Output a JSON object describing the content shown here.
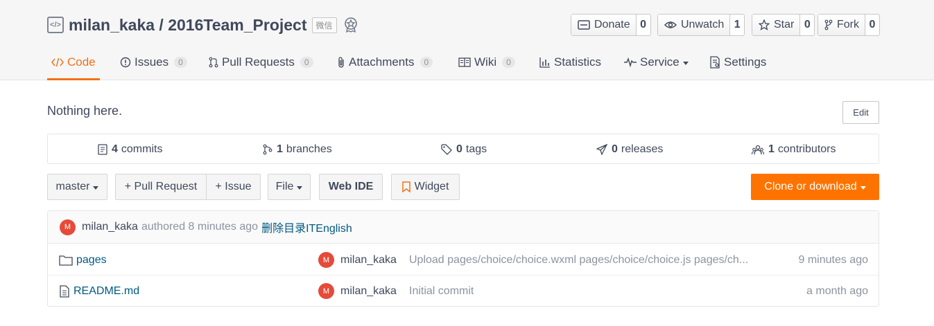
{
  "repo": {
    "title": "milan_kaka / 2016Team_Project",
    "badge": "微信"
  },
  "actions": [
    {
      "label": "Donate",
      "count": "0"
    },
    {
      "label": "Unwatch",
      "count": "1"
    },
    {
      "label": "Star",
      "count": "0"
    },
    {
      "label": "Fork",
      "count": "0"
    }
  ],
  "tabs": [
    {
      "label": "Code",
      "count": null
    },
    {
      "label": "Issues",
      "count": "0"
    },
    {
      "label": "Pull Requests",
      "count": "0"
    },
    {
      "label": "Attachments",
      "count": "0"
    },
    {
      "label": "Wiki",
      "count": "0"
    },
    {
      "label": "Statistics",
      "count": null
    },
    {
      "label": "Service",
      "count": null
    },
    {
      "label": "Settings",
      "count": null
    }
  ],
  "description": "Nothing here.",
  "edit_label": "Edit",
  "stats": [
    {
      "num": "4",
      "label": "commits"
    },
    {
      "num": "1",
      "label": "branches"
    },
    {
      "num": "0",
      "label": "tags"
    },
    {
      "num": "0",
      "label": "releases"
    },
    {
      "num": "1",
      "label": "contributors"
    }
  ],
  "toolbar": {
    "branch": "master",
    "pull_request": "+ Pull Request",
    "issue": "+ Issue",
    "file": "File",
    "web_ide": "Web IDE",
    "widget": "Widget",
    "clone": "Clone or download"
  },
  "last_commit": {
    "avatar": "M",
    "author": "milan_kaka",
    "meta": "authored 8 minutes ago",
    "message": "删除目录ITEnglish"
  },
  "files": [
    {
      "name": "pages",
      "avatar": "M",
      "author": "milan_kaka",
      "message": "Upload pages/choice/choice.wxml pages/choice/choice.js pages/ch...",
      "time": "9 minutes ago"
    },
    {
      "name": "README.md",
      "avatar": "M",
      "author": "milan_kaka",
      "message": "Initial commit",
      "time": "a month ago"
    }
  ],
  "colors": {
    "accent": "#f27119",
    "clone_button": "#fe7300",
    "link": "#005980",
    "avatar": "#e64a39"
  }
}
